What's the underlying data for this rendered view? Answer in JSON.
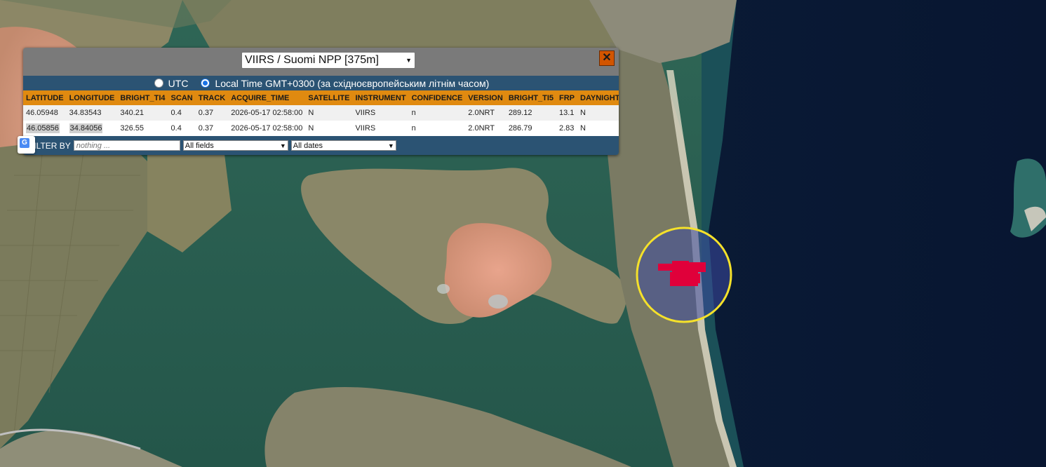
{
  "popup": {
    "layer_selected": "VIIRS / Suomi NPP [375m]",
    "close_label": "✕",
    "time_options": {
      "utc": "UTC",
      "local": "Local Time GMT+0300 (за східноєвропейським літнім часом)",
      "selected": "local"
    },
    "table": {
      "headers": [
        "LATITUDE",
        "LONGITUDE",
        "BRIGHT_TI4",
        "SCAN",
        "TRACK",
        "ACQUIRE_TIME",
        "SATELLITE",
        "INSTRUMENT",
        "CONFIDENCE",
        "VERSION",
        "BRIGHT_TI5",
        "FRP",
        "DAYNIGHT"
      ],
      "rows": [
        [
          "46.05948",
          "34.83543",
          "340.21",
          "0.4",
          "0.37",
          "2026-05-17 02:58:00",
          "N",
          "VIIRS",
          "n",
          "2.0NRT",
          "289.12",
          "13.1",
          "N"
        ],
        [
          "46.05856",
          "34.84056",
          "326.55",
          "0.4",
          "0.37",
          "2026-05-17 02:58:00",
          "N",
          "VIIRS",
          "n",
          "2.0NRT",
          "286.79",
          "2.83",
          "N"
        ]
      ]
    },
    "filter": {
      "label": "FILTER BY",
      "placeholder": "nothing ...",
      "field_select": "All fields",
      "date_select": "All dates"
    }
  },
  "map": {
    "highlight_circle_color": "#f5e12a",
    "fire_color": "#e0003a"
  },
  "icons": {
    "translate": "google-translate-icon"
  }
}
